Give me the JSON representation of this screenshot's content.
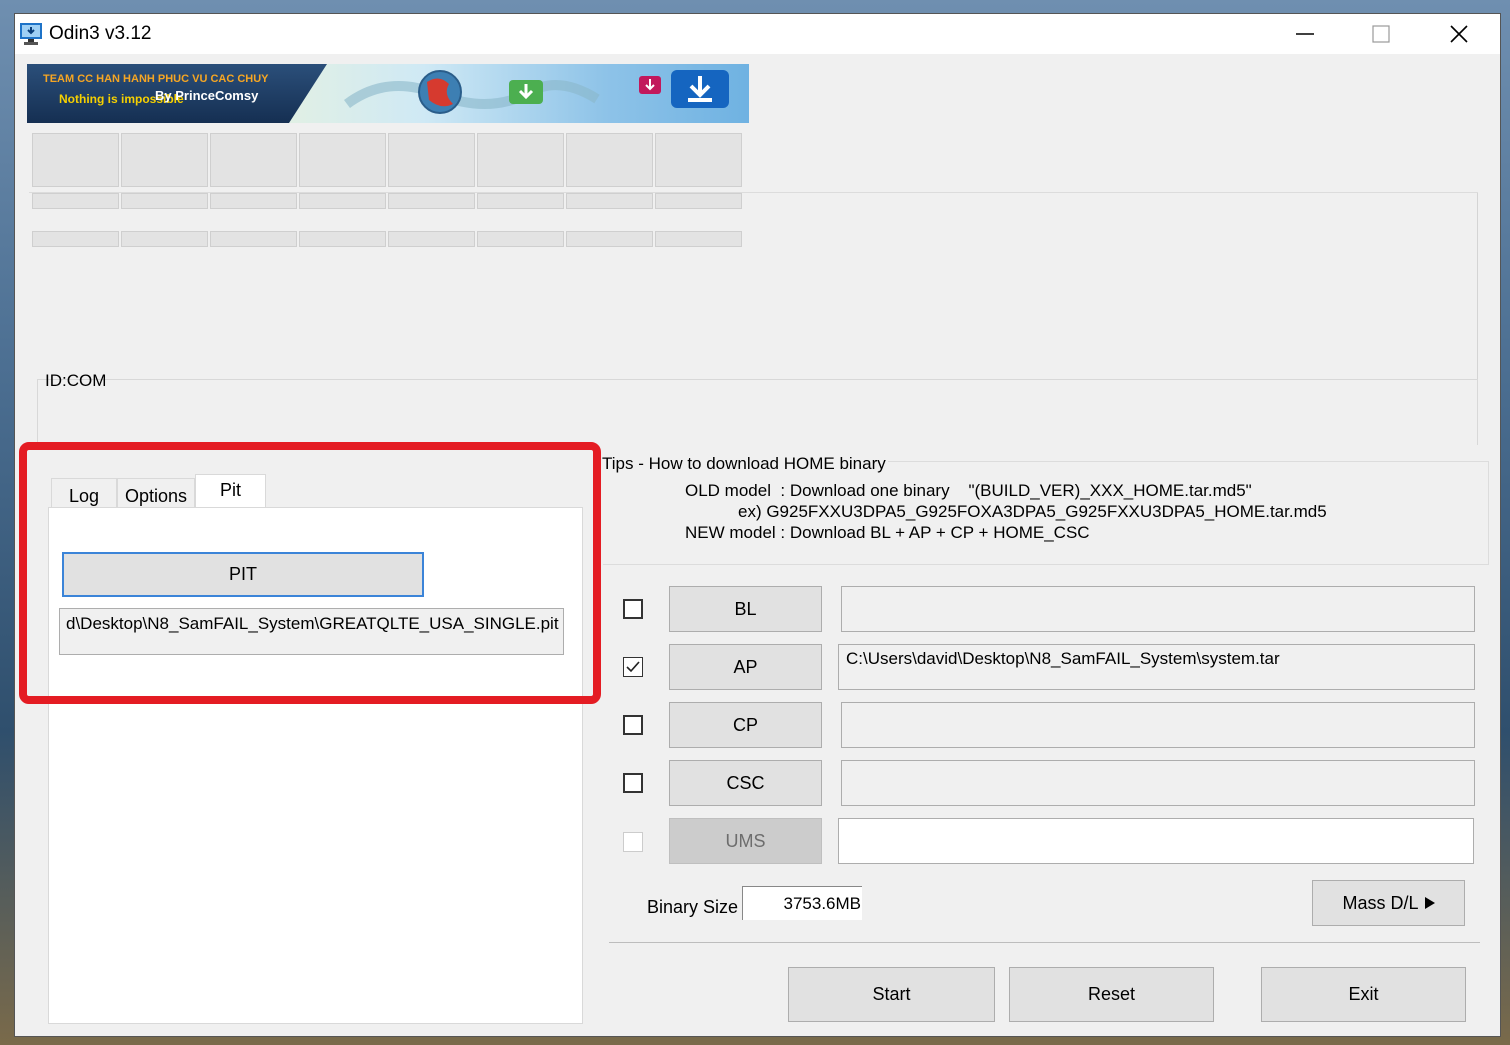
{
  "window": {
    "title": "Odin3 v3.12",
    "icons": [
      "app-icon",
      "minimize-icon",
      "maximize-icon",
      "close-icon"
    ]
  },
  "banner": {
    "line1": "TEAM CC HAN HANH PHUC VU CAC CHUY",
    "line2": "Nothing is impossible",
    "line3": "By PrinceComsy"
  },
  "idcom": {
    "label": "ID:COM"
  },
  "tabs": {
    "log": "Log",
    "options": "Options",
    "pit": "Pit"
  },
  "pit": {
    "button_label": "PIT",
    "path": "d\\Desktop\\N8_SamFAIL_System\\GREATQLTE_USA_SINGLE.pit"
  },
  "tips": {
    "title": "Tips - How to download HOME binary",
    "line1": "OLD model  : Download one binary    \"(BUILD_VER)_XXX_HOME.tar.md5\"",
    "line2": "ex) G925FXXU3DPA5_G925FOXA3DPA5_G925FXXU3DPA5_HOME.tar.md5",
    "line3": "NEW model : Download BL + AP + CP + HOME_CSC"
  },
  "files": [
    {
      "label": "BL",
      "checked": false,
      "path": ""
    },
    {
      "label": "AP",
      "checked": true,
      "path": "C:\\Users\\david\\Desktop\\N8_SamFAIL_System\\system.tar"
    },
    {
      "label": "CP",
      "checked": false,
      "path": ""
    },
    {
      "label": "CSC",
      "checked": false,
      "path": ""
    },
    {
      "label": "UMS",
      "checked": false,
      "path": ""
    }
  ],
  "binary": {
    "label": "Binary Size",
    "value": "3753.6MB"
  },
  "buttons": {
    "mass": "Mass D/L",
    "start": "Start",
    "reset": "Reset",
    "exit": "Exit"
  },
  "colors": {
    "highlight": "#e41c23",
    "pit_border": "#3b84d8"
  }
}
